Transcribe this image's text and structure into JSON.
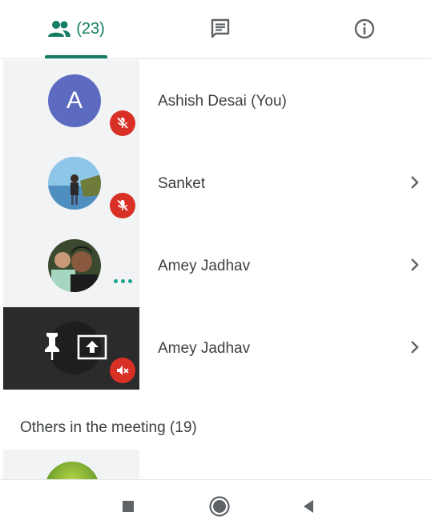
{
  "tabs": {
    "people_count": "(23)",
    "active": "people"
  },
  "participants": [
    {
      "name": "Ashish Desai (You)",
      "avatar_letter": "A",
      "avatar_color": "#5c6bc0",
      "muted": true,
      "chevron": false
    },
    {
      "name": "Sanket",
      "muted": true,
      "chevron": true
    },
    {
      "name": "Amey Jadhav",
      "speaking": true,
      "chevron": true
    },
    {
      "name": "Amey Jadhav",
      "presenting": true,
      "pinned": true,
      "muted": true,
      "chevron": true
    }
  ],
  "others_section": {
    "label": "Others in the meeting (19)"
  },
  "colors": {
    "accent": "#137c63",
    "muted_badge": "#d93025",
    "avatar_bg": "#5c6bc0",
    "tile_bg": "#f1f3f4",
    "presenting_bg": "#2b2b2b"
  }
}
